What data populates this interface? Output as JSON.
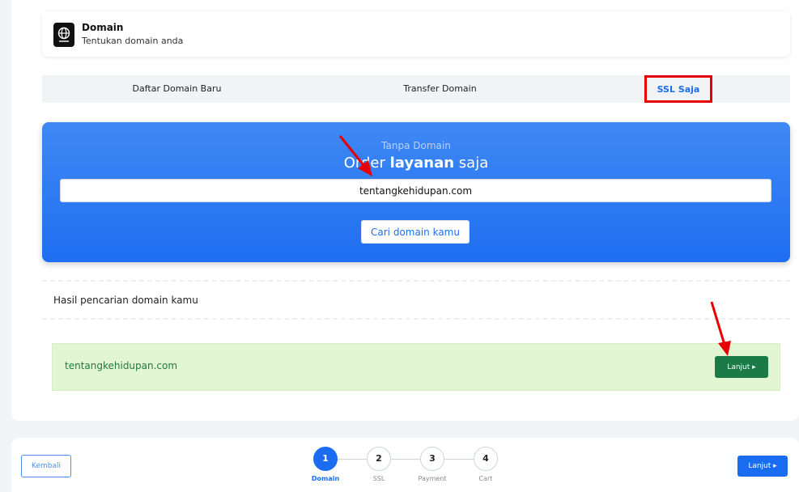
{
  "header": {
    "title": "Domain",
    "subtitle": "Tentukan domain anda",
    "icon": "globe-icon"
  },
  "tabs": [
    {
      "label": "Daftar Domain Baru"
    },
    {
      "label": "Transfer Domain"
    },
    {
      "label": "SSL Saja",
      "active": true
    }
  ],
  "hero": {
    "kicker": "Tanpa Domain",
    "title_pre": "Order",
    "title_bold": "layanan",
    "title_post": "saja",
    "input_value": "tentangkehidupan.com",
    "button_label": "Cari domain kamu"
  },
  "results": {
    "heading": "Hasil pencarian domain kamu",
    "domain": "tentangkehidupan.com",
    "continue_label": "Lanjut"
  },
  "footer": {
    "back_label": "Kembali",
    "next_label": "Lanjut",
    "steps": [
      {
        "number": "1",
        "label": "Domain",
        "active": true
      },
      {
        "number": "2",
        "label": "SSL"
      },
      {
        "number": "3",
        "label": "Payment"
      },
      {
        "number": "4",
        "label": "Cart"
      }
    ]
  },
  "colors": {
    "primary": "#1a6cf0",
    "success": "#1b7a45",
    "highlight": "#e60000"
  }
}
